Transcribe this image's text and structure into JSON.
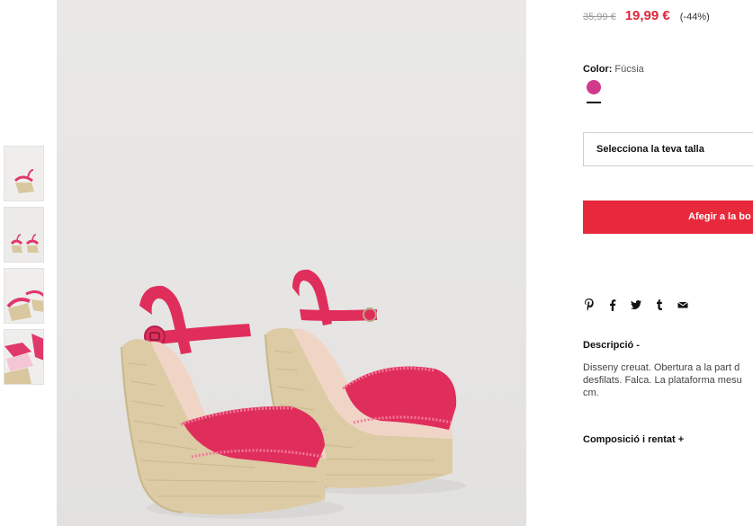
{
  "product": {
    "old_price": "35,99 €",
    "new_price": "19,99 €",
    "discount": "(-44%)",
    "color_label": "Color:",
    "color_value": "Fúcsia",
    "swatch_color": "#d13a8c",
    "accent_color": "#e8293b"
  },
  "size_select": {
    "placeholder": "Selecciona la teva talla"
  },
  "add_button": {
    "label": "Afegir a la bo"
  },
  "share": {
    "icons": [
      "pinterest-icon",
      "facebook-icon",
      "twitter-icon",
      "tumblr-icon",
      "email-icon"
    ]
  },
  "description": {
    "header": "Descripció  -",
    "lines": [
      "Disseny creuat. Obertura a la part d",
      "desfilats. Falca. La plataforma mesu",
      "cm."
    ]
  },
  "composition": {
    "header": "Composició i rentat  +"
  },
  "thumbnails": {
    "count": 4
  }
}
